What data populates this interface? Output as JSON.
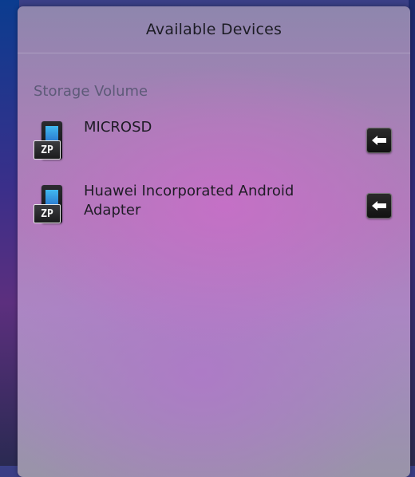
{
  "panel": {
    "title": "Available Devices",
    "section_label": "Storage Volume"
  },
  "devices": [
    {
      "name": "MICROSD",
      "icon": "portable-device-icon",
      "badge": "ZP",
      "action_icon": "unmount-icon"
    },
    {
      "name": "Huawei Incorporated Android Adapter",
      "icon": "portable-device-icon",
      "badge": "ZP",
      "action_icon": "unmount-icon"
    }
  ],
  "colors": {
    "panel_top": "#8e86ad",
    "panel_mid": "#b07cbb",
    "section_label": "#5d5a78",
    "text": "#1f1c26"
  }
}
